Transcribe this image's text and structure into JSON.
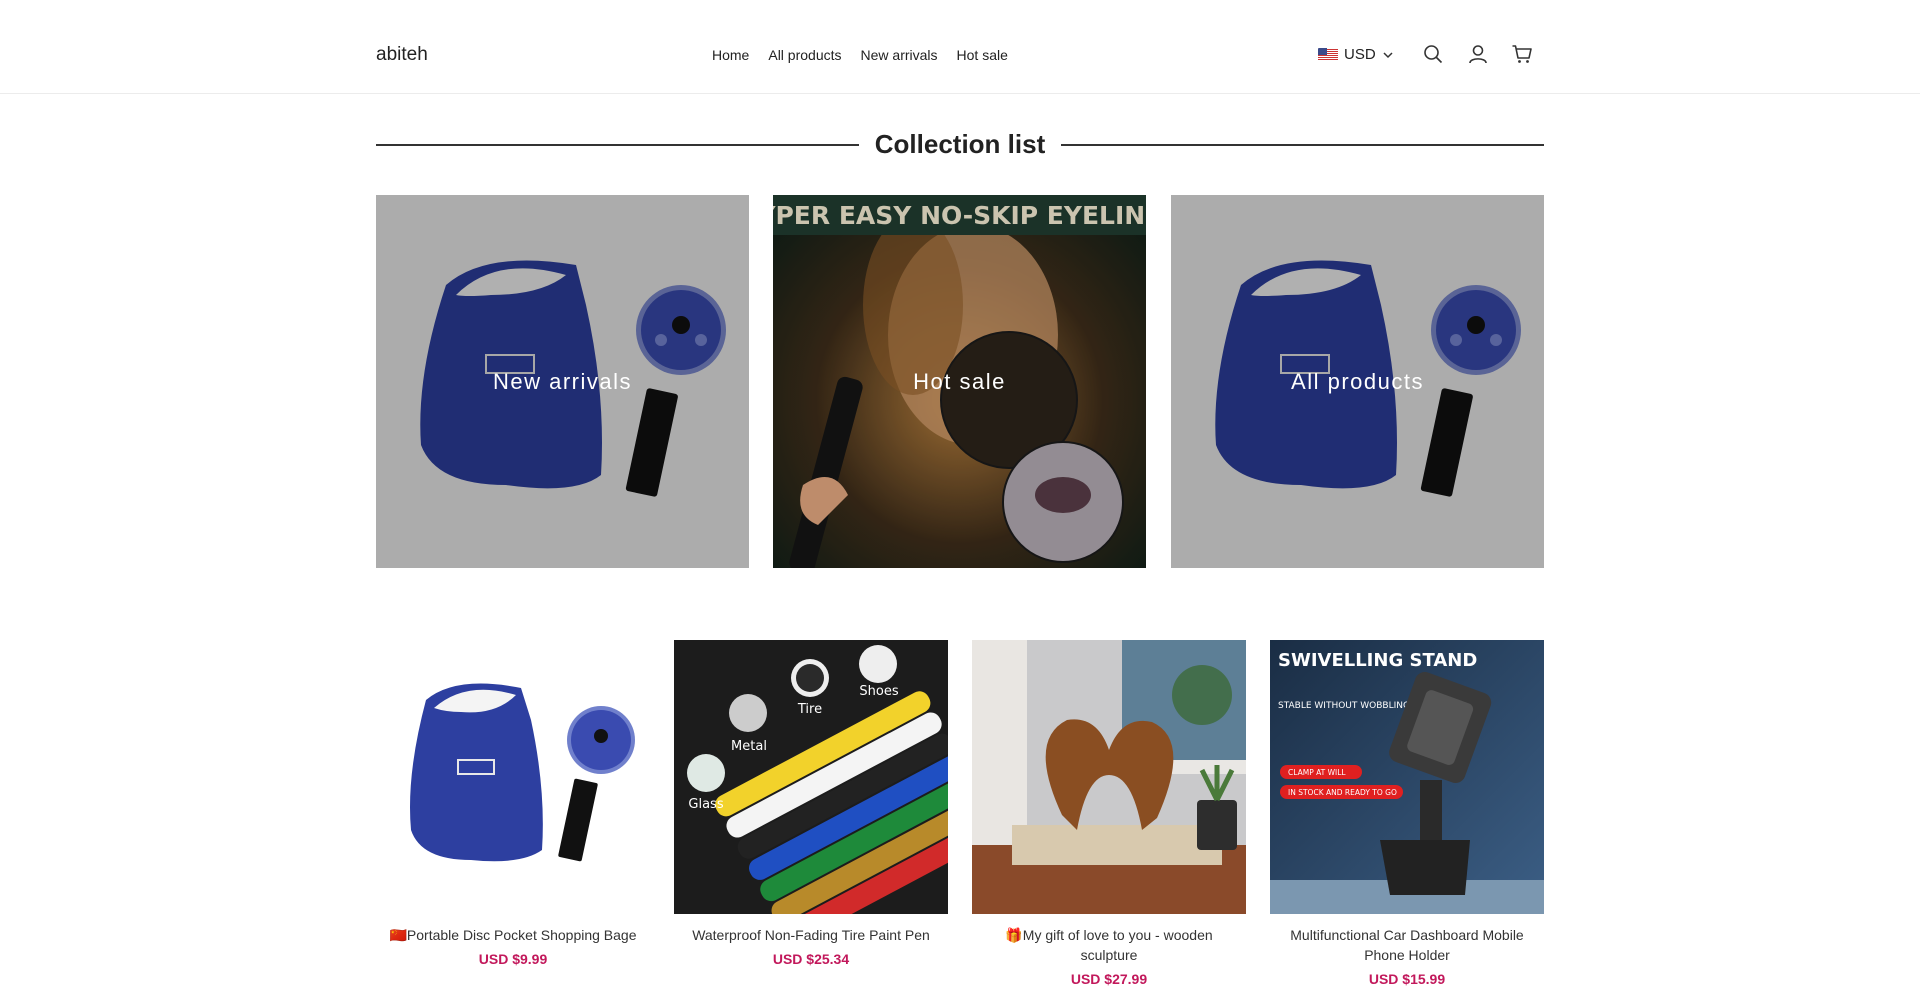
{
  "header": {
    "logo": "abiteh",
    "nav": [
      "Home",
      "All products",
      "New arrivals",
      "Hot sale"
    ],
    "currency": "USD"
  },
  "section": {
    "title": "Collection list"
  },
  "collections": [
    {
      "label": "New arrivals"
    },
    {
      "label": "Hot sale",
      "banner": "HYPER EASY NO-SKIP EYELINER"
    },
    {
      "label": "All products"
    }
  ],
  "products": [
    {
      "title": "🇨🇳Portable Disc Pocket Shopping Bage",
      "price": "USD $9.99"
    },
    {
      "title": "Waterproof Non-Fading Tire Paint Pen",
      "price": "USD $25.34",
      "tags": [
        "Tire",
        "Shoes",
        "Metal",
        "Glass"
      ]
    },
    {
      "title": "🎁My gift of love to you - wooden sculpture",
      "price": "USD $27.99"
    },
    {
      "title": "Multifunctional Car Dashboard Mobile Phone Holder",
      "price": "USD $15.99",
      "headline": "SWIVELLING STAND",
      "sub": "STABLE WITHOUT WOBBLING",
      "badge1": "CLAMP AT WILL",
      "badge2": "IN STOCK AND READY TO GO"
    }
  ],
  "colors": {
    "price": "#c2185b",
    "bag_blue": "#2d3fa0"
  }
}
